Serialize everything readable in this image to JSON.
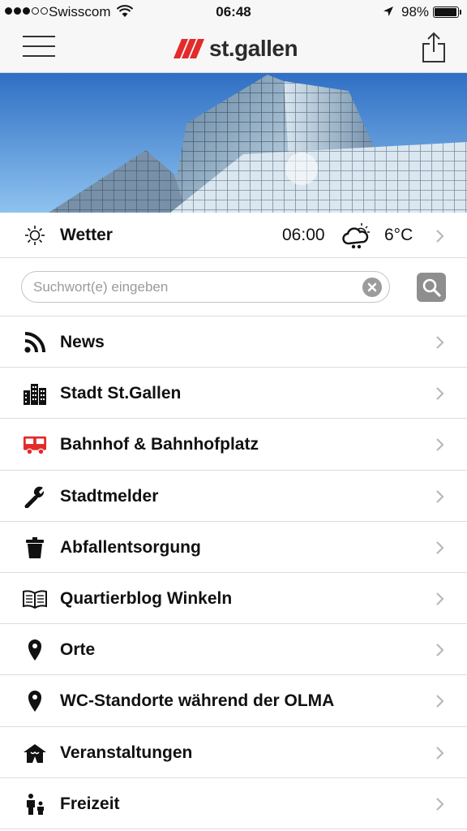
{
  "status_bar": {
    "carrier": "Swisscom",
    "time": "06:48",
    "battery": "98%",
    "battery_level": 0.98
  },
  "header": {
    "logo_text": "st.gallen",
    "brand_color": "#e32b2b"
  },
  "weather": {
    "label": "Wetter",
    "time": "06:00",
    "condition_icon": "cloud-sun-rain-icon",
    "temperature": "6°C"
  },
  "search": {
    "placeholder": "Suchwort(e) eingeben"
  },
  "menu": [
    {
      "label": "News",
      "icon": "rss-icon"
    },
    {
      "label": "Stadt St.Gallen",
      "icon": "city-buildings-icon"
    },
    {
      "label": "Bahnhof & Bahnhofplatz",
      "icon": "bus-icon"
    },
    {
      "label": "Stadtmelder",
      "icon": "wrench-icon"
    },
    {
      "label": "Abfallentsorgung",
      "icon": "trash-icon"
    },
    {
      "label": "Quartierblog Winkeln",
      "icon": "open-book-icon"
    },
    {
      "label": "Orte",
      "icon": "map-pin-icon"
    },
    {
      "label": "WC-Standorte während der OLMA",
      "icon": "map-pin-icon"
    },
    {
      "label": "Veranstaltungen",
      "icon": "tent-icon"
    },
    {
      "label": "Freizeit",
      "icon": "family-icon"
    }
  ]
}
